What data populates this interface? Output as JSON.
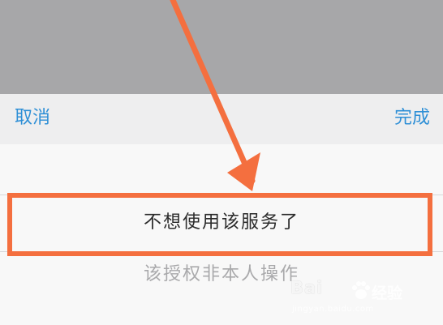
{
  "toolbar": {
    "cancel_label": "取消",
    "done_label": "完成"
  },
  "picker": {
    "selected_option": "不想使用该服务了",
    "next_option": "该授权非本人操作"
  },
  "annotation": {
    "accent_color": "#f46f3f"
  },
  "watermark": {
    "logo_text": "Bai",
    "sub_text": "经验",
    "url_text": "jingyan.baidu.com"
  }
}
